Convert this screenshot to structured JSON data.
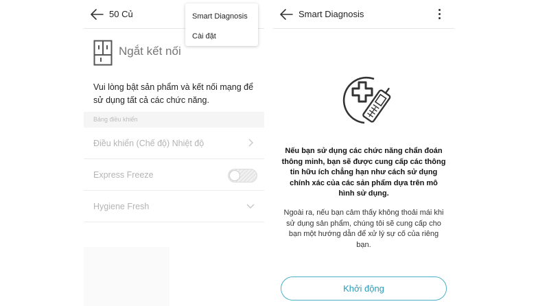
{
  "left_screen": {
    "header": {
      "title": "50 Củ",
      "back_icon": "back-arrow-icon"
    },
    "menu": {
      "items": [
        "Smart Diagnosis",
        "Cài đặt"
      ]
    },
    "status": {
      "icon": "fridge-icon",
      "title": "Ngắt kết nối"
    },
    "notice": "Vui lòng bật sản phẩm và kết nối mạng để sử dụng tất cả các chức năng.",
    "section_label": "Bảng điều khiển",
    "rows": [
      {
        "label": "Điều khiển (Chế độ) Nhiệt độ",
        "control": "chevron-right-icon"
      },
      {
        "label": "Express Freeze",
        "control": "toggle",
        "state": "off"
      },
      {
        "label": "Hygiene Fresh",
        "control": "chevron-down-icon"
      }
    ]
  },
  "right_screen": {
    "header": {
      "title": "Smart Diagnosis",
      "back_icon": "back-arrow-icon",
      "menu_icon": "kebab-menu-icon"
    },
    "illustration": "medical-cross-phone-icon",
    "description_1": "Nếu bạn sử dụng các chức năng chẩn đoán thông minh, bạn sẽ được cung cấp các thông tin hữu ích chẳng hạn như cách sử dụng chính xác của các sản phẩm dựa trên mô hình sử dụng.",
    "description_2": "Ngoài ra, nếu bạn cảm thấy không thoải mái khi sử dụng sản phẩm, chúng tôi sẽ cung cấp cho bạn một hướng dẫn để xử lý sự cố của riêng bạn.",
    "start_button": "Khởi động"
  },
  "colors": {
    "accent": "#2a9bb8",
    "accent_border": "#4ab0c8",
    "muted_text": "#b4b4b4",
    "divider": "#ececec"
  }
}
